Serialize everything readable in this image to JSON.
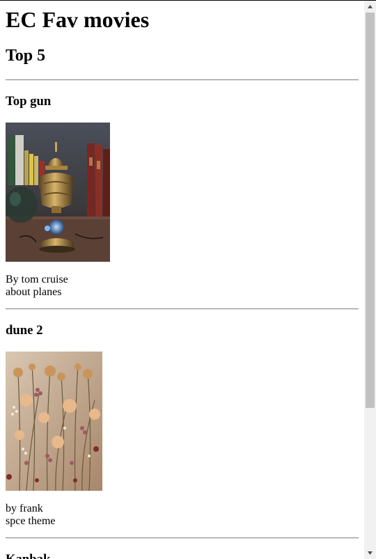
{
  "page": {
    "title": "EC Fav movies",
    "subtitle": "Top 5"
  },
  "movies": [
    {
      "title": "Top gun",
      "line1": "By tom cruise",
      "line2": "about planes",
      "image_icon": "ornate-incense-burner-photo"
    },
    {
      "title": "dune 2",
      "line1": "by frank",
      "line2": "spce theme",
      "image_icon": "dried-flowers-photo"
    },
    {
      "title": "Kanbak",
      "line1": "",
      "line2": "",
      "image_icon": ""
    }
  ],
  "scrollbar": {
    "position_fraction": 0.0,
    "visible_fraction": 0.74,
    "up_icon": "triangle-up-icon",
    "down_icon": "triangle-down-icon"
  },
  "colors": {
    "background": "#ffffff",
    "text": "#000000",
    "rule": "#8f8f8f",
    "scrollbar_track": "#f1f1f1",
    "scrollbar_thumb": "#c1c1c1"
  }
}
